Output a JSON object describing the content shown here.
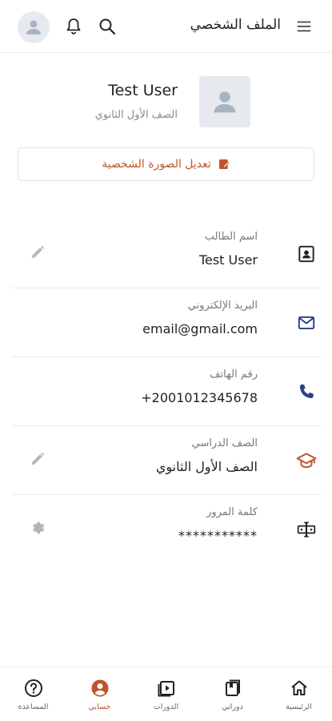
{
  "header": {
    "title": "الملف الشخصي",
    "icons": [
      "menu-icon",
      "search-icon",
      "bell-icon",
      "avatar-icon"
    ]
  },
  "profile": {
    "name": "Test User",
    "grade": "الصف الأول الثانوي",
    "edit_photo_label": "تعديل الصورة الشخصية"
  },
  "fields": [
    {
      "label": "اسم الطالب",
      "value": "Test User",
      "icon": "id-card-icon",
      "action": "edit-icon"
    },
    {
      "label": "البريد الإلكتروني",
      "value": "email@gmail.com",
      "icon": "mail-icon"
    },
    {
      "label": "رقم الهاتف",
      "value": "+2001012345678",
      "icon": "phone-icon"
    },
    {
      "label": "الصف الدراسي",
      "value": "الصف الأول الثانوي",
      "icon": "graduation-cap-icon",
      "action": "edit-icon"
    },
    {
      "label": "كلمة المرور",
      "value": "***********",
      "icon": "password-icon",
      "action": "gear-icon"
    }
  ],
  "bottom_nav": [
    {
      "label": "الرئيسية",
      "icon": "home-icon",
      "active": false
    },
    {
      "label": "دوراتي",
      "icon": "my-courses-icon",
      "active": false
    },
    {
      "label": "الدورات",
      "icon": "courses-play-icon",
      "active": false
    },
    {
      "label": "حسابي",
      "icon": "account-icon",
      "active": true
    },
    {
      "label": "المساعدة",
      "icon": "help-icon",
      "active": false
    }
  ],
  "colors": {
    "accent": "#c0532a",
    "blue_icon": "#2a3f8f",
    "divider": "#ececec",
    "avatar_bg": "#e6eaef"
  }
}
